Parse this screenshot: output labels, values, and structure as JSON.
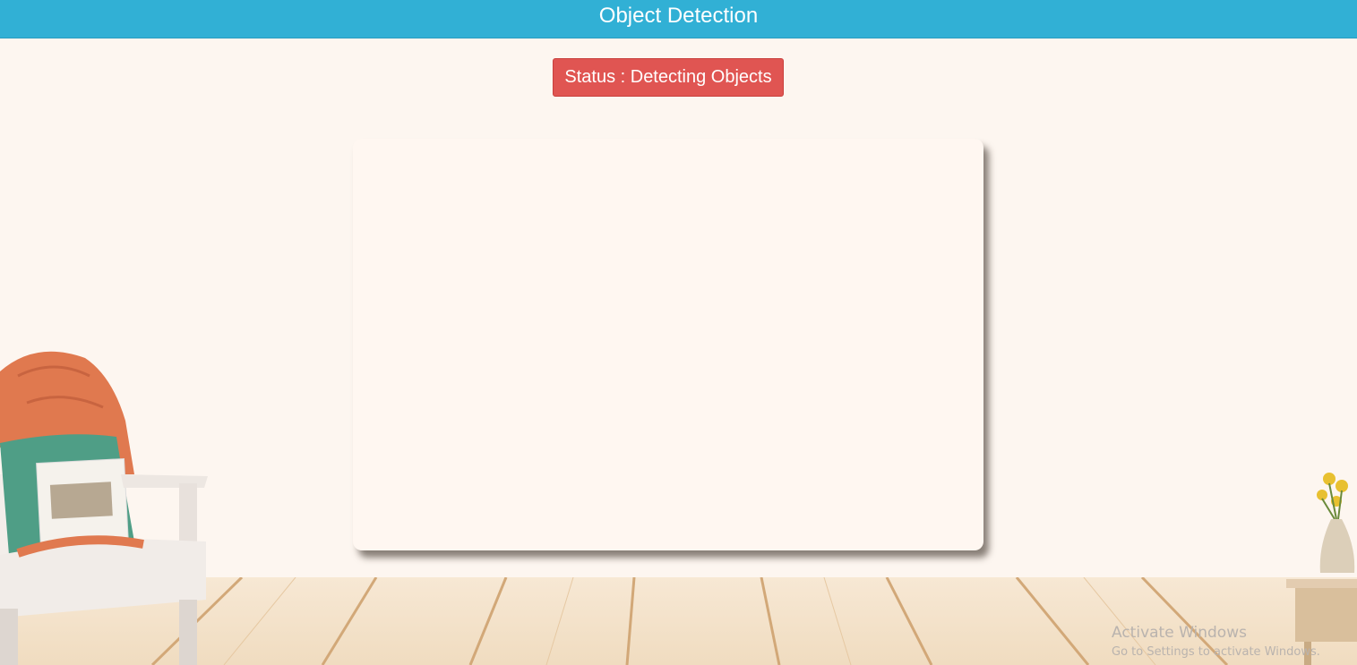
{
  "header": {
    "title": "Object Detection"
  },
  "status": {
    "label": "Status : Detecting Objects"
  },
  "watermark": {
    "line1": "Activate Windows",
    "line2": "Go to Settings to activate Windows."
  },
  "colors": {
    "header_bg": "#31b0d5",
    "status_bg": "#e05552",
    "page_bg": "#fdf6f0"
  },
  "decor": {
    "armchair_icon": "armchair-with-blanket-and-pillow",
    "vase_icon": "vase-with-sunflowers",
    "floor": "wooden-floor-planks"
  }
}
